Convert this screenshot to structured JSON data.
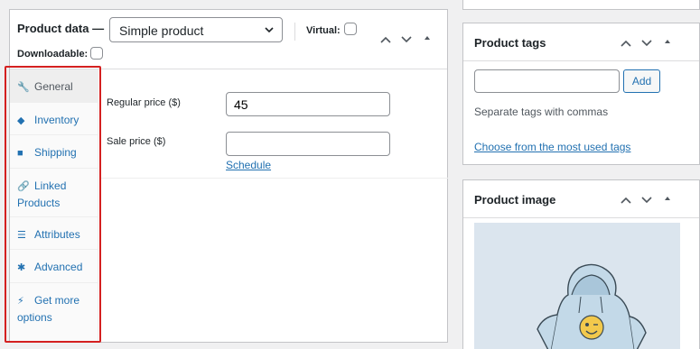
{
  "product_data": {
    "title": "Product data —",
    "product_type": "Simple product",
    "virtual_label": "Virtual:",
    "downloadable_label": "Downloadable:",
    "tabs": [
      {
        "label": "General",
        "icon": "wrench-icon",
        "glyph": "🔧"
      },
      {
        "label": "Inventory",
        "icon": "tag-icon",
        "glyph": "◆"
      },
      {
        "label": "Shipping",
        "icon": "truck-icon",
        "glyph": "■"
      },
      {
        "label": "Linked Products",
        "icon": "link-icon",
        "glyph": "🔗"
      },
      {
        "label": "Attributes",
        "icon": "list-icon",
        "glyph": "☰"
      },
      {
        "label": "Advanced",
        "icon": "gear-icon",
        "glyph": "✱"
      },
      {
        "label": "Get more options",
        "icon": "plugin-icon",
        "glyph": "⚡"
      }
    ],
    "general": {
      "regular_price_label": "Regular price ($)",
      "regular_price_value": "45",
      "sale_price_label": "Sale price ($)",
      "sale_price_value": "",
      "schedule_link": "Schedule"
    }
  },
  "tags_box": {
    "title": "Product tags",
    "add_button": "Add",
    "hint": "Separate tags with commas",
    "choose_link": "Choose from the most used tags"
  },
  "image_box": {
    "title": "Product image"
  },
  "colors": {
    "accent": "#2271b1",
    "highlight": "#d42020"
  }
}
